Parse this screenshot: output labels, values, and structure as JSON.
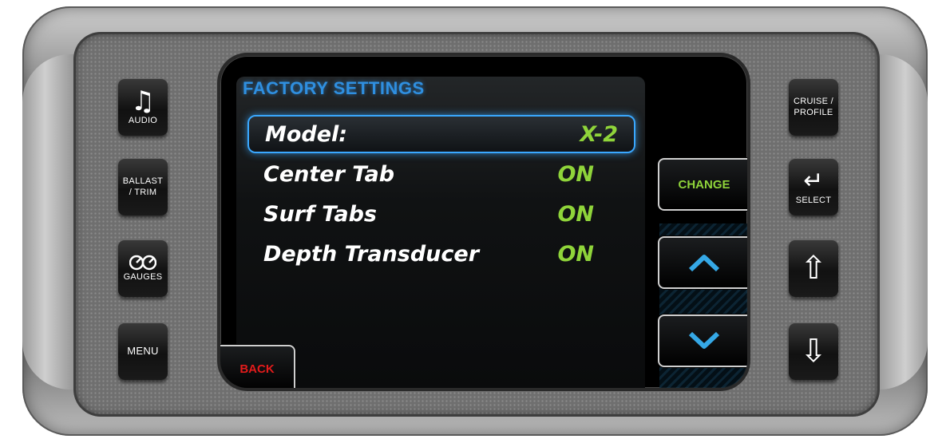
{
  "left_buttons": [
    {
      "label": "AUDIO",
      "icon": "music-note-icon",
      "glyph": "♫"
    },
    {
      "label": "BALLAST\n/ TRIM"
    },
    {
      "label": "GAUGES",
      "icon": "gauges-icon"
    },
    {
      "label": "MENU"
    }
  ],
  "right_buttons": [
    {
      "label": "CRUISE /\nPROFILE"
    },
    {
      "label": "SELECT",
      "icon": "enter-arrow-icon",
      "glyph": "↵"
    },
    {
      "label": "",
      "icon": "up-arrow-icon",
      "glyph": "⇧"
    },
    {
      "label": "",
      "icon": "down-arrow-icon",
      "glyph": "⇩"
    }
  ],
  "screen": {
    "title": "FACTORY SETTINGS",
    "rows": [
      {
        "label": "Model:",
        "value": "X-2",
        "selected": true
      },
      {
        "label": "Center Tab",
        "value": "ON"
      },
      {
        "label": "Surf Tabs",
        "value": "ON"
      },
      {
        "label": "Depth Transducer",
        "value": "ON"
      }
    ],
    "change_label": "CHANGE",
    "back_label": "BACK",
    "up_icon": "chevron-up-icon",
    "down_icon": "chevron-down-icon"
  },
  "colors": {
    "title_blue": "#2f8fe0",
    "value_green": "#8fd43a",
    "back_red": "#e21b1b",
    "arrow_blue": "#35a8e6",
    "selection_glow": "#3aa8ff"
  }
}
